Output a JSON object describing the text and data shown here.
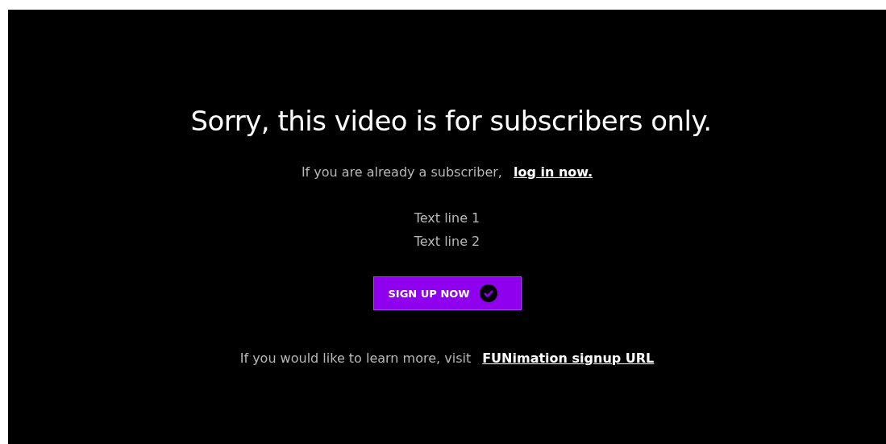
{
  "heading": "Sorry, this video is for subscribers only.",
  "login": {
    "text": "If you are already a subscriber,",
    "link": "log in now."
  },
  "text_lines": [
    "Text line 1",
    "Text line 2"
  ],
  "signup_button": {
    "label": "SIGN UP NOW"
  },
  "learn_more": {
    "text": "If you would like to learn more, visit",
    "link": "FUNimation signup URL"
  }
}
